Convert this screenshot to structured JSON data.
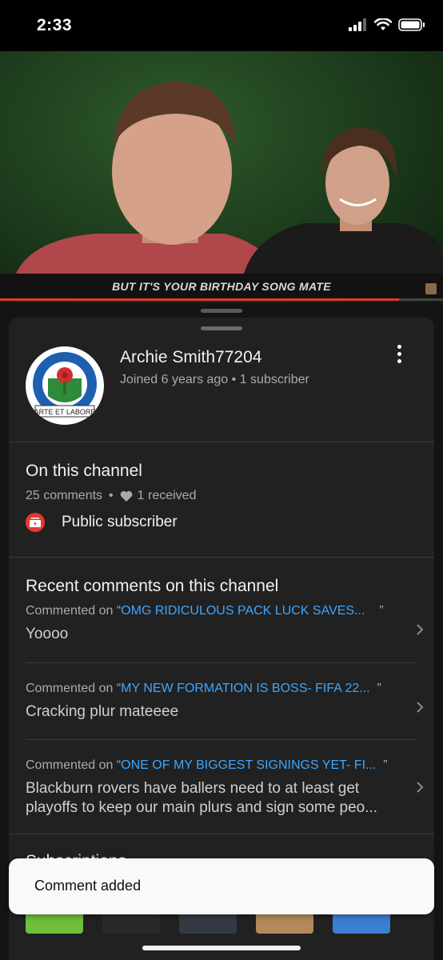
{
  "status_bar": {
    "time": "2:33"
  },
  "video": {
    "caption": "BUT IT'S YOUR BIRTHDAY SONG MATE",
    "progress": 0.9
  },
  "channel": {
    "name": "Archie Smith77204",
    "meta": "Joined 6 years ago • 1 subscriber",
    "avatar_text": "BLACKBURN ROVERS F.C.",
    "avatar_motto": "ARTE ET LABORE"
  },
  "on_this_channel": {
    "title": "On this channel",
    "comments_count": "25 comments",
    "separator": "•",
    "received": "1 received",
    "public_label": "Public subscriber"
  },
  "recent_comments": {
    "title": "Recent comments on this channel",
    "commented_on_prefix": "Commented on “",
    "items": [
      {
        "video_title": "OMG RIDICULOUS PACK LUCK SAVES...",
        "text": "Yoooo"
      },
      {
        "video_title": "MY NEW FORMATION IS BOSS- FIFA 22...",
        "text": "Cracking plur mateeee"
      },
      {
        "video_title": "ONE OF MY BIGGEST SIGNINGS YET- FI...",
        "text": "Blackburn rovers have ballers need to at least get playoffs to keep our main plurs and sign some peo..."
      }
    ],
    "close_quote": "”"
  },
  "subscriptions": {
    "title": "Subscriptions"
  },
  "toast": {
    "text": "Comment added"
  },
  "colors": {
    "accent_red": "#e53935",
    "link_blue": "#3ea6ff",
    "sheet_bg": "#212121"
  }
}
